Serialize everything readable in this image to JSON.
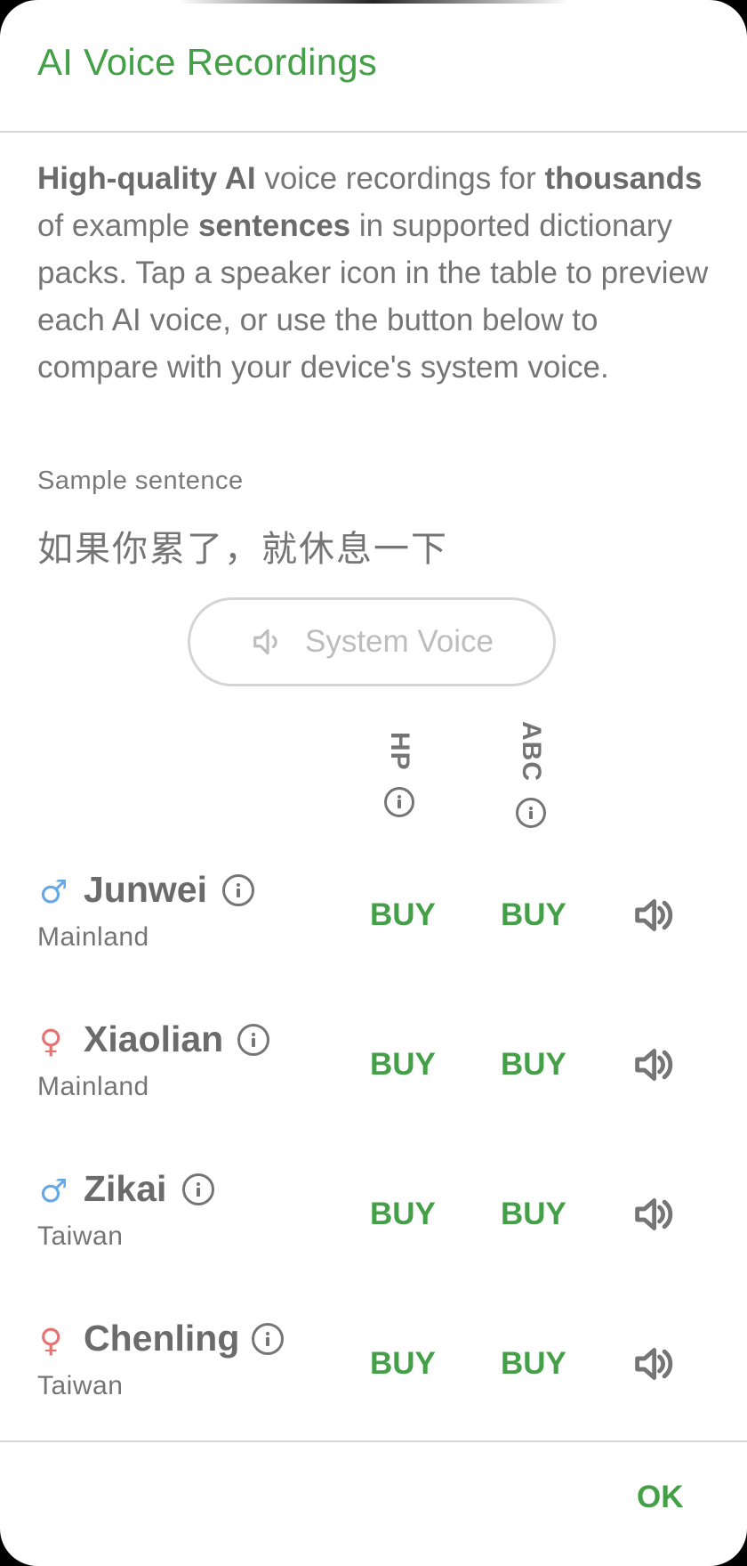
{
  "dialog": {
    "title": "AI Voice Recordings",
    "description": {
      "p1_bold": "High-quality AI",
      "p2": " voice recordings for ",
      "p3_bold": "thousands",
      "p4": " of example ",
      "p5_bold": "sentences",
      "p6": " in supported dictionary packs. Tap a speaker icon in the table to preview each AI voice, or use the button below to compare with your device's system voice."
    },
    "sample_label": "Sample sentence",
    "sample_text": "如果你累了，就休息一下",
    "system_voice_button": "System Voice",
    "columns": [
      "HP",
      "ABC"
    ],
    "voices": [
      {
        "gender": "♂",
        "gender_color": "#64a8e8",
        "name": "Junwei",
        "region": "Mainland",
        "hp": "BUY",
        "abc": "BUY"
      },
      {
        "gender": "♀",
        "gender_color": "#e57373",
        "name": "Xiaolian",
        "region": "Mainland",
        "hp": "BUY",
        "abc": "BUY"
      },
      {
        "gender": "♂",
        "gender_color": "#64a8e8",
        "name": "Zikai",
        "region": "Taiwan",
        "hp": "BUY",
        "abc": "BUY"
      },
      {
        "gender": "♀",
        "gender_color": "#e57373",
        "name": "Chenling",
        "region": "Taiwan",
        "hp": "BUY",
        "abc": "BUY"
      }
    ],
    "ok_button": "OK",
    "accent_color": "#43a047"
  }
}
